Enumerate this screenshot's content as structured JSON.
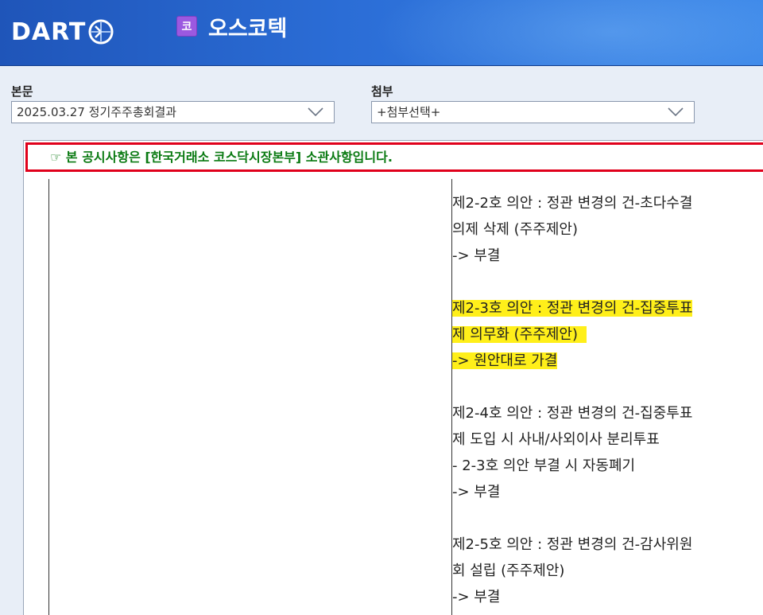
{
  "header": {
    "logo_text": "DART",
    "corp_badge": "코",
    "corp_name": "오스코텍"
  },
  "main_doc": {
    "label": "본문",
    "selected": "2025.03.27  정기주주총회결과"
  },
  "attachment": {
    "label": "첨부",
    "selected": "+첨부선택+"
  },
  "notice": {
    "icon": "pointing-hand-icon",
    "text": "☞ 본 공시사항은 [한국거래소 코스닥시장본부] 소관사항입니다."
  },
  "colors": {
    "header_blue": "#2b6dd6",
    "notice_border": "#e0001b",
    "notice_text": "#0a7a12",
    "highlight": "#ffef1a"
  },
  "agenda": [
    {
      "lines": [
        "제2-2호 의안 : 정관 변경의 건-초다수결",
        "의제 삭제 (주주제안)",
        "-> 부결"
      ],
      "highlighted": false
    },
    {
      "lines": [
        "제2-3호 의안 : 정관 변경의 건-집중투표",
        "제 의무화 (주주제안)",
        "-> 원안대로 가결"
      ],
      "highlighted": true
    },
    {
      "lines": [
        "제2-4호 의안 : 정관 변경의 건-집중투표",
        "제 도입 시 사내/사외이사 분리투표",
        "- 2-3호 의안 부결 시 자동폐기",
        "-> 부결"
      ],
      "highlighted": false
    },
    {
      "lines": [
        "제2-5호 의안 : 정관 변경의 건-감사위원",
        "회 설립 (주주제안)",
        "-> 부결"
      ],
      "highlighted": false
    }
  ]
}
